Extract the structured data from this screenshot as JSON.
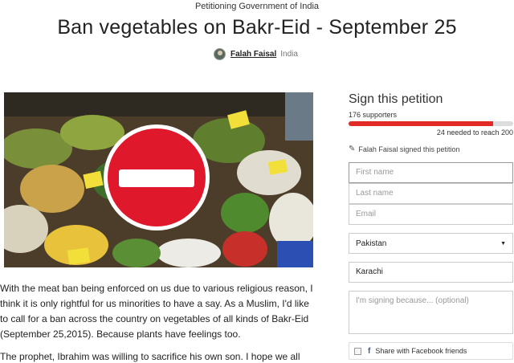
{
  "header": {
    "targeting": "Petitioning Government of India",
    "title": "Ban vegetables on Bakr-Eid - September 25",
    "author_name": "Falah Faisal",
    "author_location": "India"
  },
  "petition": {
    "paragraphs": [
      "With the meat ban being enforced on us due to various religious reason, I think it is only rightful for us minorities to have a say. As a Muslim, I'd like to call for a ban across the country on vegetables of all kinds of Bakr-Eid (September 25,2015). Because plants have feelings too.",
      "The prophet, Ibrahim was willing to sacrifice his own son. I hope we all"
    ]
  },
  "sidebar": {
    "sign_title": "Sign this petition",
    "supporters": "176 supporters",
    "progress_fraction": 0.88,
    "progress_color": "#e22a26",
    "needed": "24 needed to reach 200",
    "recent_signer": "Falah Faisal signed this petition",
    "recent_icon": "pen-icon"
  },
  "form": {
    "first_name_placeholder": "First name",
    "last_name_placeholder": "Last name",
    "email_placeholder": "Email",
    "country_value": "Pakistan",
    "city_value": "Karachi",
    "reason_placeholder": "I'm signing because... (optional)",
    "facebook_label": "Share with Facebook friends",
    "facebook_icon": "facebook-icon"
  }
}
